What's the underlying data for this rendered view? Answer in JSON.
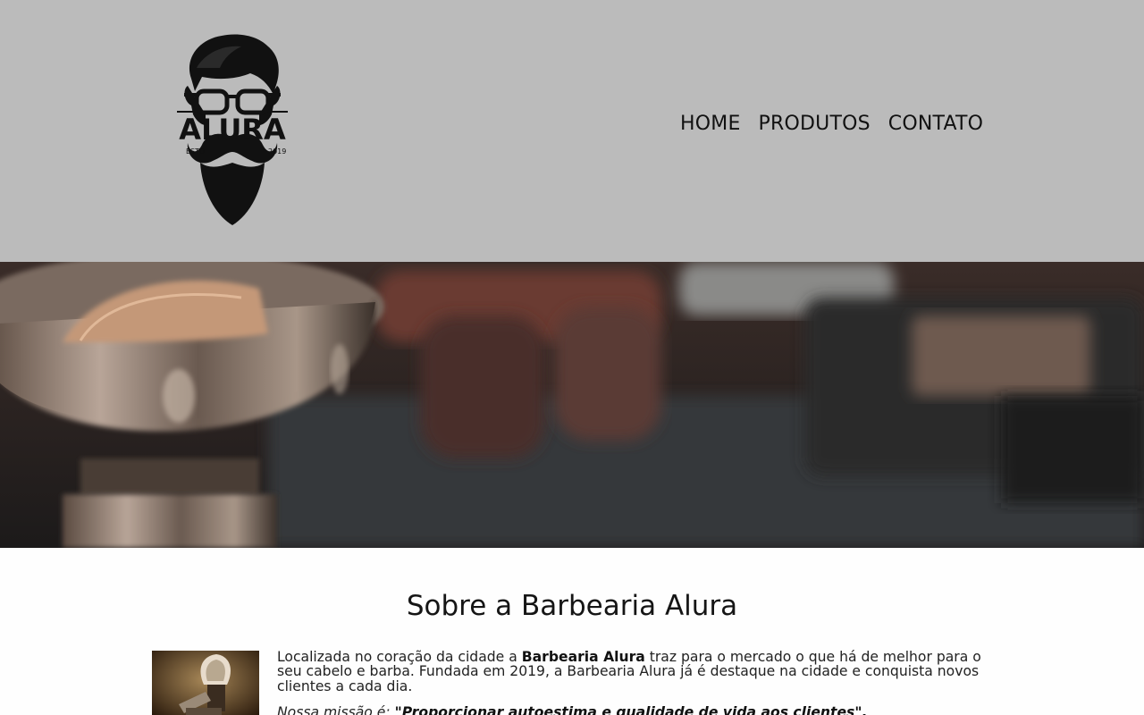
{
  "header": {
    "logo": {
      "brand": "ALURA",
      "est_left": "ESTO",
      "est_right": "2019",
      "icon": "bearded-man-logo-icon"
    },
    "nav": [
      {
        "label": "HOME"
      },
      {
        "label": "PRODUTOS"
      },
      {
        "label": "CONTATO"
      }
    ]
  },
  "banner": {
    "icon": "barber-tools-photo"
  },
  "main": {
    "title": "Sobre a Barbearia Alura",
    "thumbnail_icon": "shaving-brush-photo",
    "about": {
      "p1_pre": "Localizada no coração da cidade a ",
      "p1_bold": "Barbearia Alura",
      "p1_post": " traz para o mercado o que há de melhor para o seu cabelo e barba. Fundada em 2019, a Barbearia Alura já é destaque na cidade e conquista novos clientes a cada dia.",
      "mission_label": "Nossa missão é: ",
      "mission_text": "\"Proporcionar autoestima e qualidade de vida aos clientes\"."
    }
  },
  "colors": {
    "header_bg": "#bbbbbb",
    "page_bg": "#fefefe",
    "text": "#111111"
  }
}
